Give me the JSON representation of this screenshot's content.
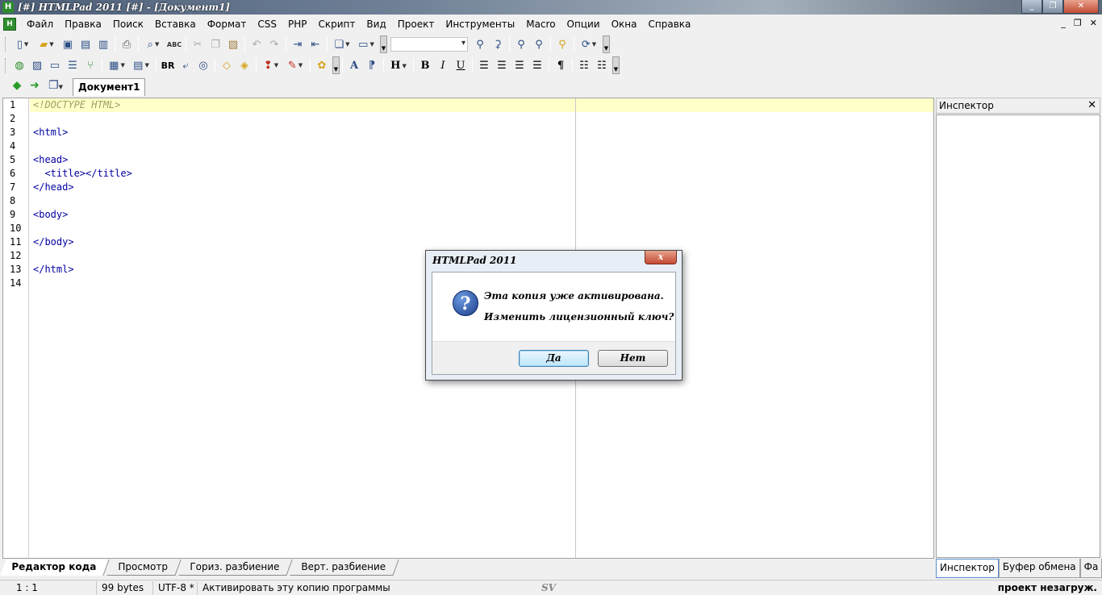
{
  "window": {
    "title": "[#] HTMLPad 2011 [#] - [Документ1]",
    "app_icon": "H",
    "minimize": "_",
    "restore": "❐",
    "close": "✕"
  },
  "menu": {
    "items": [
      "Файл",
      "Правка",
      "Поиск",
      "Вставка",
      "Формат",
      "CSS",
      "PHP",
      "Скрипт",
      "Вид",
      "Проект",
      "Инструменты",
      "Macro",
      "Опции",
      "Окна",
      "Справка"
    ],
    "mdi_min": "_",
    "mdi_restore": "❐",
    "mdi_close": "✕"
  },
  "toolbar2_text": {
    "br": "BR",
    "heading": "H",
    "bold": "B",
    "italic": "I",
    "underline": "U",
    "para": "¶",
    "abc": "ABC"
  },
  "doc_tabs": {
    "active": "Документ1"
  },
  "editor": {
    "line_numbers": [
      "1",
      "2",
      "3",
      "4",
      "5",
      "6",
      "7",
      "8",
      "9",
      "10",
      "11",
      "12",
      "13",
      "14"
    ],
    "lines": [
      "<!DOCTYPE HTML>",
      "",
      "<html>",
      "",
      "<head>",
      "  <title></title>",
      "</head>",
      "",
      "<body>",
      "",
      "</body>",
      "",
      "</html>",
      ""
    ],
    "colors": {
      "active_line": "#ffffc8",
      "tag": "#0000a0",
      "doctype": "#a0a060"
    }
  },
  "inspector": {
    "title": "Инспектор",
    "close": "✕",
    "tabs": [
      "Инспектор",
      "Буфер обмена",
      "Фа"
    ],
    "prev": "◀",
    "next": "▶"
  },
  "editor_tabs": [
    "Редактор кода",
    "Просмотр",
    "Гориз. разбиение",
    "Верт. разбиение"
  ],
  "status": {
    "position": "1 : 1",
    "size": "99 bytes",
    "encoding": "UTF-8 *",
    "message": "Активировать эту копию программы",
    "sv": "SV",
    "project": "проект незагруж."
  },
  "dialog": {
    "title": "HTMLPad 2011",
    "close": "x",
    "icon": "?",
    "message1": "Эта копия уже активирована.",
    "message2": "Изменить лицензионный ключ?",
    "yes": "Да",
    "no": "Нет"
  }
}
